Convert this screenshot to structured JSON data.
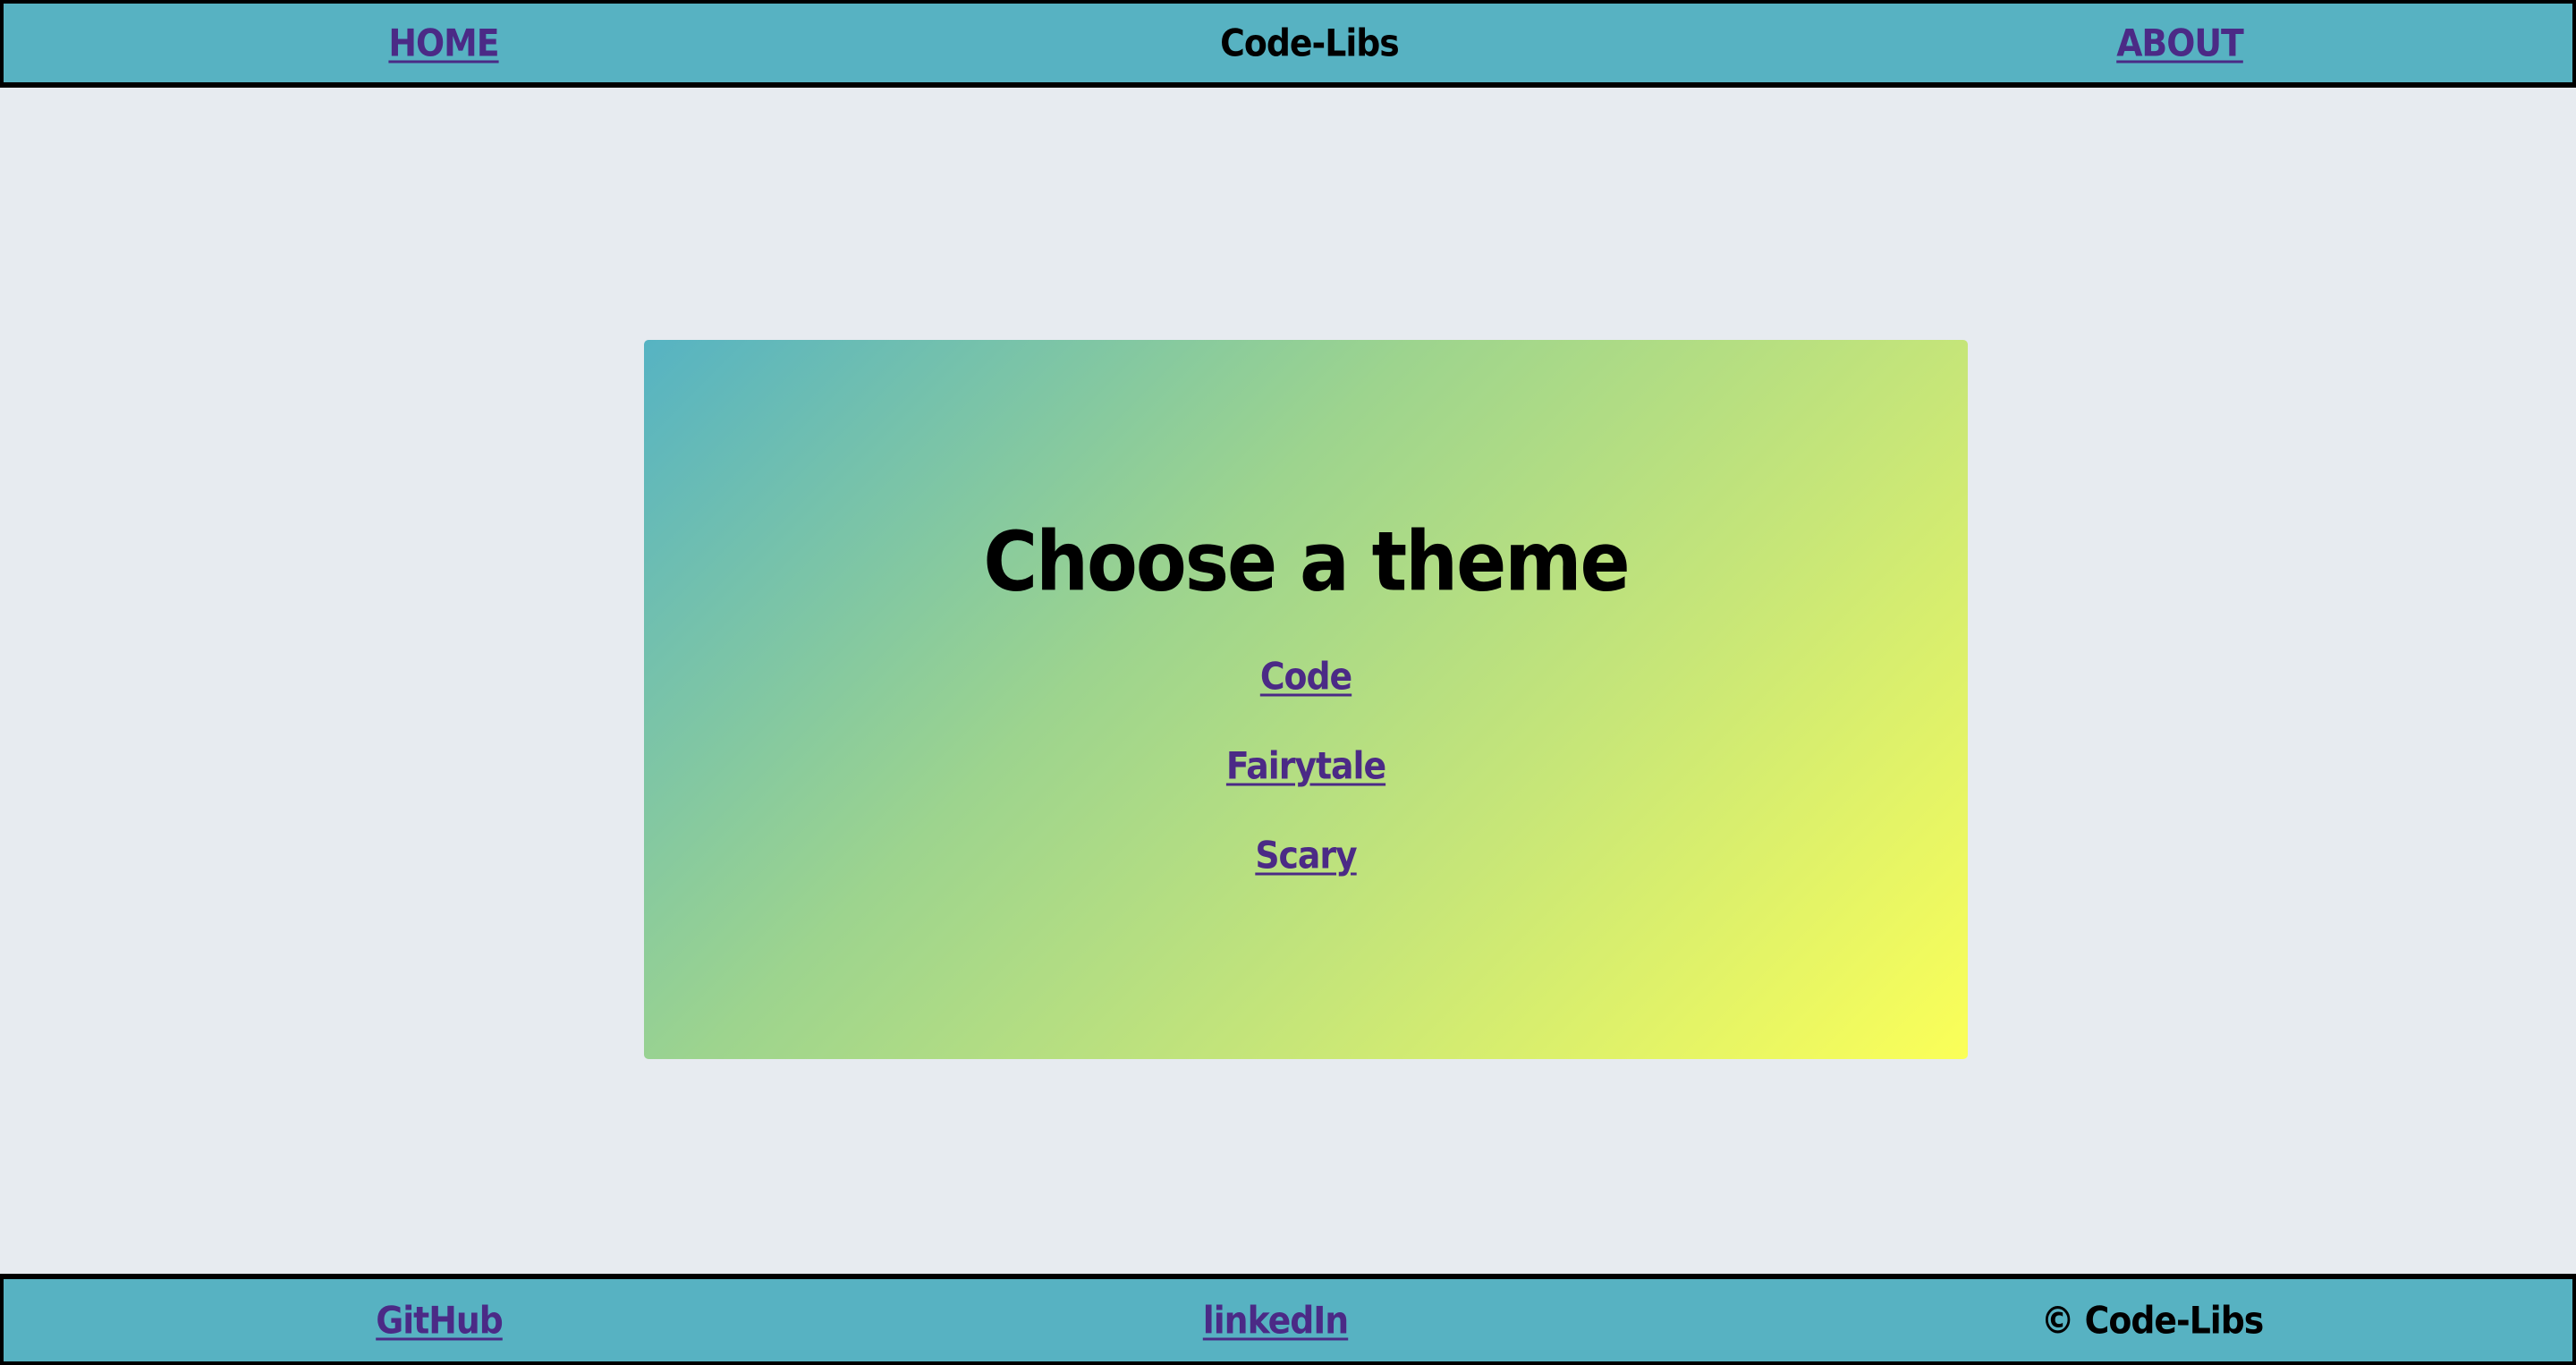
{
  "header": {
    "home_label": "HOME",
    "brand": "Code-Libs",
    "about_label": "ABOUT"
  },
  "main": {
    "title": "Choose a theme",
    "themes": [
      {
        "label": "Code"
      },
      {
        "label": "Fairytale"
      },
      {
        "label": "Scary"
      }
    ]
  },
  "footer": {
    "github_label": "GitHub",
    "linkedin_label": "linkedIn",
    "copyright": "© Code-Libs"
  },
  "colors": {
    "bar_background": "#57b2c2",
    "page_background": "#e7ebf0",
    "link": "#4b2a86",
    "gradient_start": "#56b3c3",
    "gradient_end": "#fbff58"
  }
}
